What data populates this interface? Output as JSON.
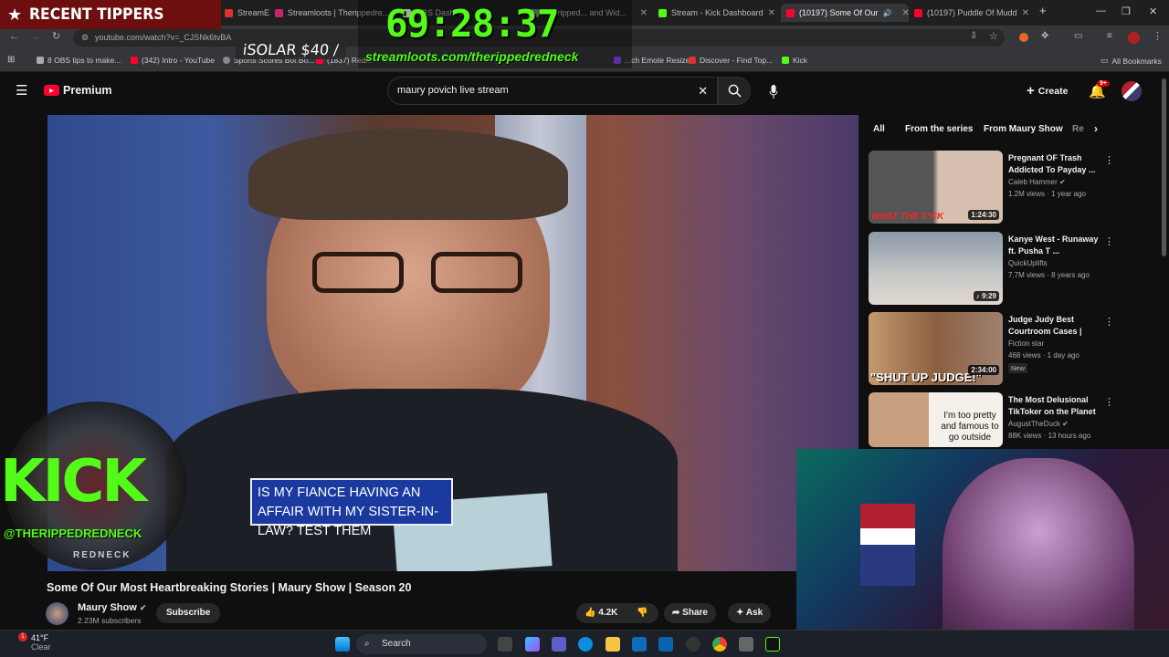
{
  "browser": {
    "tabs": [
      {
        "label": "StreamElements - Theripped...",
        "color": "#e0312e",
        "active": false
      },
      {
        "label": "Streamloots | Therippedre...",
        "color": "#c7256b",
        "active": false
      },
      {
        "label": "OBS Dashbo...",
        "color": "#ffffff",
        "active": false
      },
      {
        "label": "Theripped... and Wid...",
        "color": "#888888",
        "active": false
      },
      {
        "label": "Stream - Kick Dashboard",
        "color": "#53fc18",
        "active": false
      },
      {
        "label": "(10197) Some Of Our",
        "color": "#ff0033",
        "active": true
      },
      {
        "label": "(10197) Puddle Of Mudd",
        "color": "#ff0033",
        "active": false
      }
    ],
    "new_tab_label": "+",
    "url": "youtube.com/watch?v=_CJSNk6tvBA",
    "bookmarks": [
      {
        "label": "8 OBS tips to make...",
        "color": "#aaaaaa"
      },
      {
        "label": "(342) Intro - YouTube",
        "color": "#ff0033"
      },
      {
        "label": "Sports Scores Bot Bo...",
        "color": "#888888"
      },
      {
        "label": "(1837) Red...",
        "color": "#ff0033"
      },
      {
        "label": "...ch Emote Resizer",
        "color": "#9146ff"
      },
      {
        "label": "Discover - Find Top...",
        "color": "#e0312e"
      },
      {
        "label": "Kick",
        "color": "#53fc18"
      }
    ],
    "all_bookmarks_label": "All Bookmarks"
  },
  "youtube": {
    "logo_label": "Premium",
    "search_query": "maury povich live stream",
    "create_label": "Create",
    "notif_count": "9+",
    "chips": [
      "All",
      "From the series",
      "From Maury Show",
      "Re"
    ],
    "recommendations": [
      {
        "title": "Pregnant OF Trash Addicted To Payday ...",
        "channel": "Caleb Hammer",
        "verified": true,
        "meta": "1.2M views · 1 year ago",
        "badge": "",
        "duration": "1:24:30",
        "overlay_text": "WHAT THE F*CK"
      },
      {
        "title": "Kanye West - Runaway ft. Pusha T ...",
        "channel": "QuickUplifts",
        "verified": false,
        "meta": "7.7M views · 8 years ago",
        "badge": "",
        "duration": "9:29",
        "overlay_text": ""
      },
      {
        "title": "Judge Judy Best Courtroom Cases | Fu...",
        "channel": "Fiction star",
        "verified": false,
        "meta": "468 views · 1 day ago",
        "badge": "New",
        "duration": "2:34:00",
        "overlay_text": "\"SHUT UP JUDGE!\""
      },
      {
        "title": "The Most Delusional TikToker on the Planet",
        "channel": "AugustTheDuck",
        "verified": true,
        "meta": "88K views · 13 hours ago",
        "badge": "",
        "duration": "",
        "overlay_text": "I'm too pretty and famous to go outside"
      }
    ],
    "video": {
      "title": "Some Of Our Most Heartbreaking Stories | Maury Show | Season 20",
      "caption": "IS MY FIANCE HAVING AN AFFAIR WITH MY SISTER-IN-LAW? TEST THEM",
      "channel": "Maury Show",
      "subscribers": "2.23M subscribers",
      "subscribe_label": "Subscribe",
      "likes": "4.2K",
      "share_label": "Share",
      "ask_label": "Ask"
    }
  },
  "stream_overlay": {
    "tippers_label": "RECENT TIPPERS",
    "tipper_entry": "iSOLAR $40 /",
    "timer": "69:28:37",
    "streamloots_url": "streamloots.com/therippedredneck",
    "kick_label": "KICK",
    "kick_handle": "@THERIPPEDREDNECK",
    "kick_sub": "REDNECK"
  },
  "taskbar": {
    "weather_temp": "41°F",
    "weather_desc": "Clear",
    "weather_badge": "1",
    "search_label": "Search"
  },
  "colors": {
    "kick_green": "#53fc18",
    "youtube_red": "#ff0033",
    "tippers_bg": "#6d0f0f"
  }
}
